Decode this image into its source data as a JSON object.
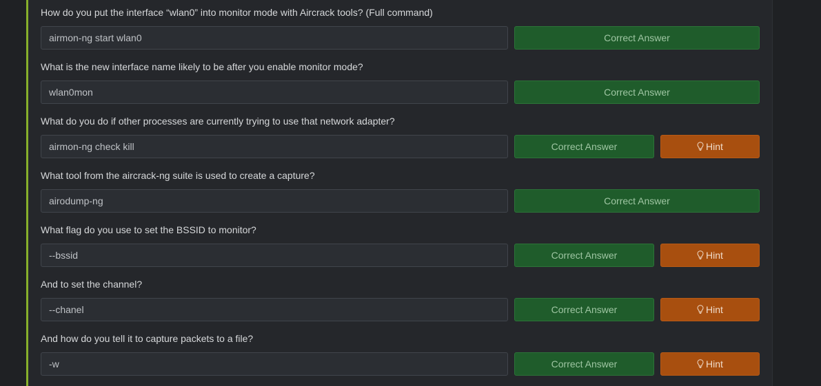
{
  "questions": [
    {
      "text": "How do you put the interface “wlan0” into monitor mode with Aircrack tools? (Full command)",
      "answer": "airmon-ng start wlan0",
      "status": "Correct Answer",
      "hint": null
    },
    {
      "text": "What is the new interface name likely to be after you enable monitor mode?",
      "answer": "wlan0mon",
      "status": "Correct Answer",
      "hint": null
    },
    {
      "text": "What do you do if other processes are currently trying to use that network adapter?",
      "answer": "airmon-ng check kill",
      "status": "Correct Answer",
      "hint": "Hint"
    },
    {
      "text": "What tool from the aircrack-ng suite is used to create a capture?",
      "answer": "airodump-ng",
      "status": "Correct Answer",
      "hint": null
    },
    {
      "text": "What flag do you use to set the BSSID to monitor?",
      "answer": "--bssid",
      "status": "Correct Answer",
      "hint": "Hint"
    },
    {
      "text": "And to set the channel?",
      "answer": "--chanel",
      "status": "Correct Answer",
      "hint": "Hint"
    },
    {
      "text": "And how do you tell it to capture packets to a file?",
      "answer": "-w",
      "status": "Correct Answer",
      "hint": "Hint"
    }
  ],
  "icons": {
    "hint": "lightbulb-icon"
  },
  "colors": {
    "accent_bar": "#87b02b",
    "correct": "#1f5c2b",
    "hint": "#a84f0f"
  }
}
